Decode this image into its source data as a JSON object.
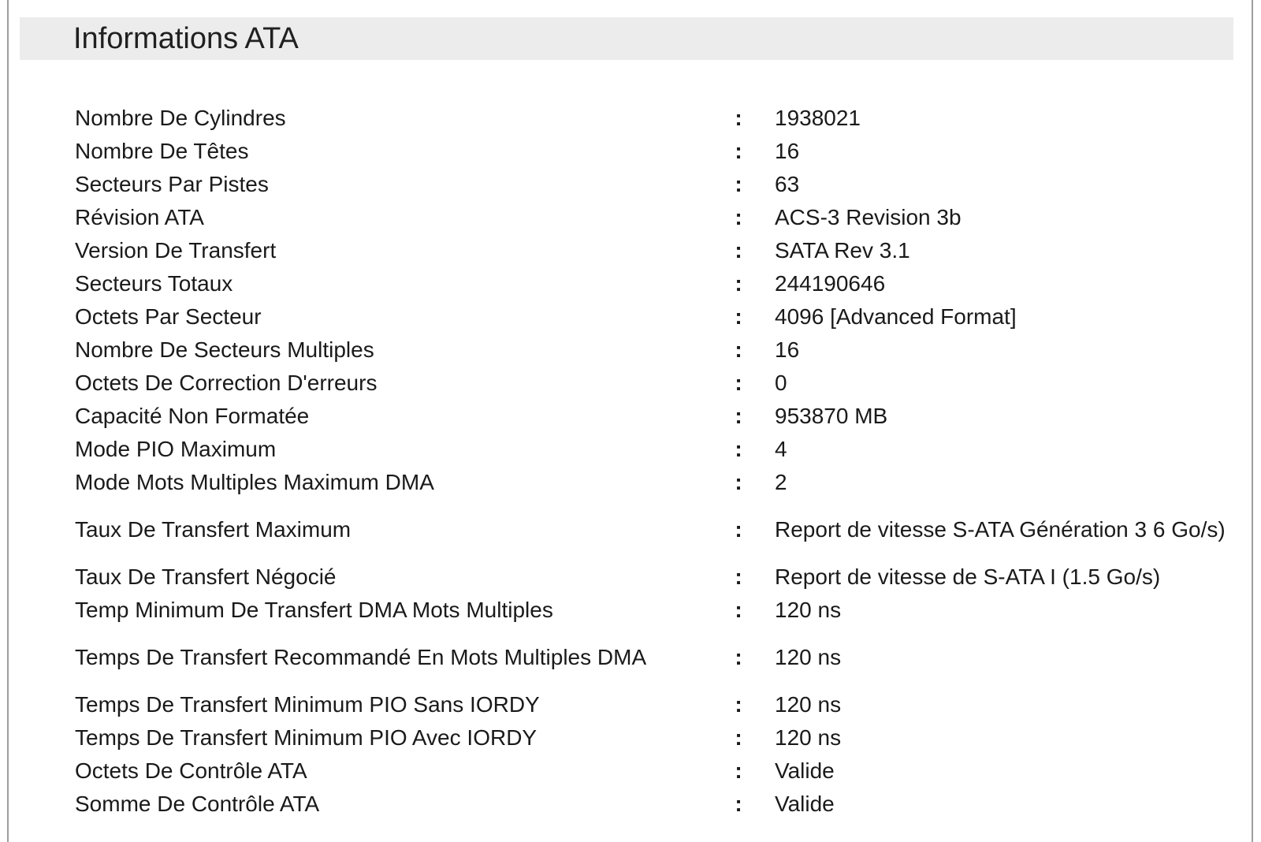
{
  "section": {
    "title": "Informations ATA"
  },
  "separator": ":",
  "rows": [
    {
      "label": "Nombre De Cylindres",
      "value": "1938021"
    },
    {
      "label": "Nombre De Têtes",
      "value": "16"
    },
    {
      "label": "Secteurs Par Pistes",
      "value": "63"
    },
    {
      "label": "Révision ATA",
      "value": "ACS-3 Revision 3b"
    },
    {
      "label": "Version De Transfert",
      "value": "SATA Rev 3.1"
    },
    {
      "label": "Secteurs Totaux",
      "value": "244190646"
    },
    {
      "label": "Octets Par Secteur",
      "value": "4096 [Advanced Format]"
    },
    {
      "label": "Nombre De Secteurs Multiples",
      "value": "16"
    },
    {
      "label": "Octets De Correction D'erreurs",
      "value": "0"
    },
    {
      "label": "Capacité Non Formatée",
      "value": "953870 MB"
    },
    {
      "label": "Mode PIO Maximum",
      "value": "4"
    },
    {
      "label": "Mode Mots Multiples Maximum DMA",
      "value": "2"
    },
    {
      "label": "Taux De Transfert Maximum",
      "value": "Report de vitesse S-ATA Génération 3 6 Go/s)"
    },
    {
      "label": "Taux De Transfert Négocié",
      "value": "Report de vitesse de S-ATA I (1.5 Go/s)"
    },
    {
      "label": "Temp Minimum De Transfert DMA Mots Multiples",
      "value": "120 ns"
    },
    {
      "label": "Temps De Transfert Recommandé En Mots Multiples DMA",
      "value": "120 ns"
    },
    {
      "label": "Temps De Transfert Minimum PIO Sans IORDY",
      "value": "120 ns"
    },
    {
      "label": "Temps De Transfert Minimum PIO Avec IORDY",
      "value": "120 ns"
    },
    {
      "label": "Octets De Contrôle ATA",
      "value": "Valide"
    },
    {
      "label": "Somme De Contrôle ATA",
      "value": "Valide"
    }
  ]
}
